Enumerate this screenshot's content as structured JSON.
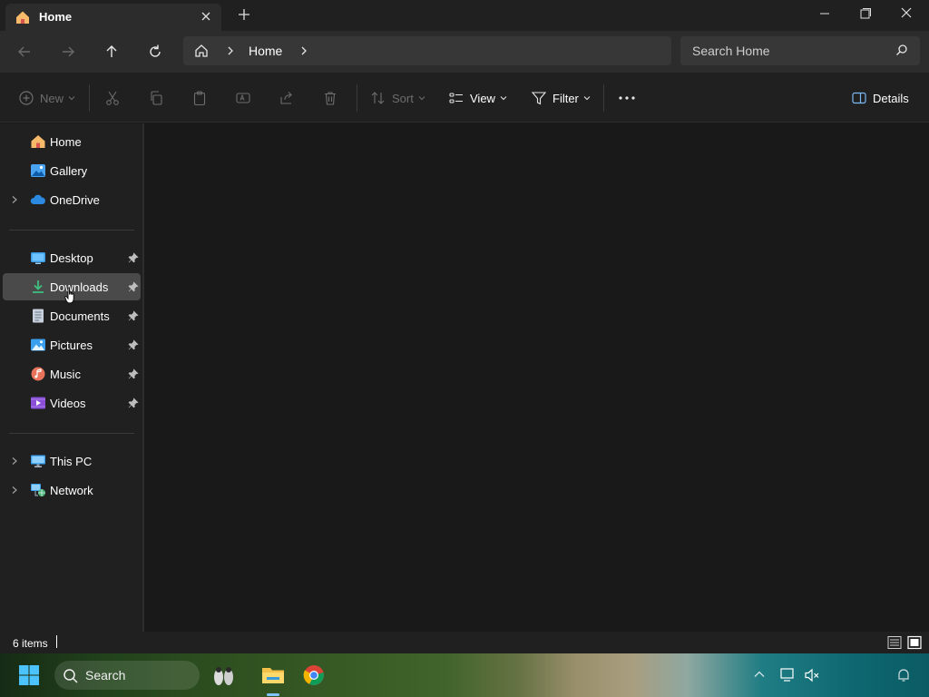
{
  "window": {
    "tab_title": "Home",
    "new_tab_symbol": "+"
  },
  "address": {
    "crumbs": [
      "Home"
    ],
    "search_placeholder": "Search Home"
  },
  "commands": {
    "new_label": "New",
    "sort_label": "Sort",
    "view_label": "View",
    "filter_label": "Filter",
    "details_label": "Details"
  },
  "sidebar": {
    "top_items": [
      {
        "label": "Home",
        "icon": "home-icon"
      },
      {
        "label": "Gallery",
        "icon": "gallery-icon"
      },
      {
        "label": "OneDrive",
        "icon": "onedrive-icon",
        "expandable": true
      }
    ],
    "pinned_items": [
      {
        "label": "Desktop",
        "icon": "desktop-folder-icon",
        "pinned": true
      },
      {
        "label": "Downloads",
        "icon": "downloads-folder-icon",
        "pinned": true,
        "selected": true
      },
      {
        "label": "Documents",
        "icon": "documents-folder-icon",
        "pinned": true
      },
      {
        "label": "Pictures",
        "icon": "pictures-folder-icon",
        "pinned": true
      },
      {
        "label": "Music",
        "icon": "music-folder-icon",
        "pinned": true
      },
      {
        "label": "Videos",
        "icon": "videos-folder-icon",
        "pinned": true
      }
    ],
    "device_items": [
      {
        "label": "This PC",
        "icon": "this-pc-icon",
        "expandable": true
      },
      {
        "label": "Network",
        "icon": "network-icon",
        "expandable": true
      }
    ]
  },
  "status": {
    "item_count": "6 items"
  },
  "taskbar": {
    "search_label": "Search"
  },
  "colors": {
    "background": "#191919",
    "chrome": "#202020",
    "selected": "#4a4a4a",
    "folder_yellow": "#f5c04a",
    "accent_blue": "#3a9bdc"
  }
}
